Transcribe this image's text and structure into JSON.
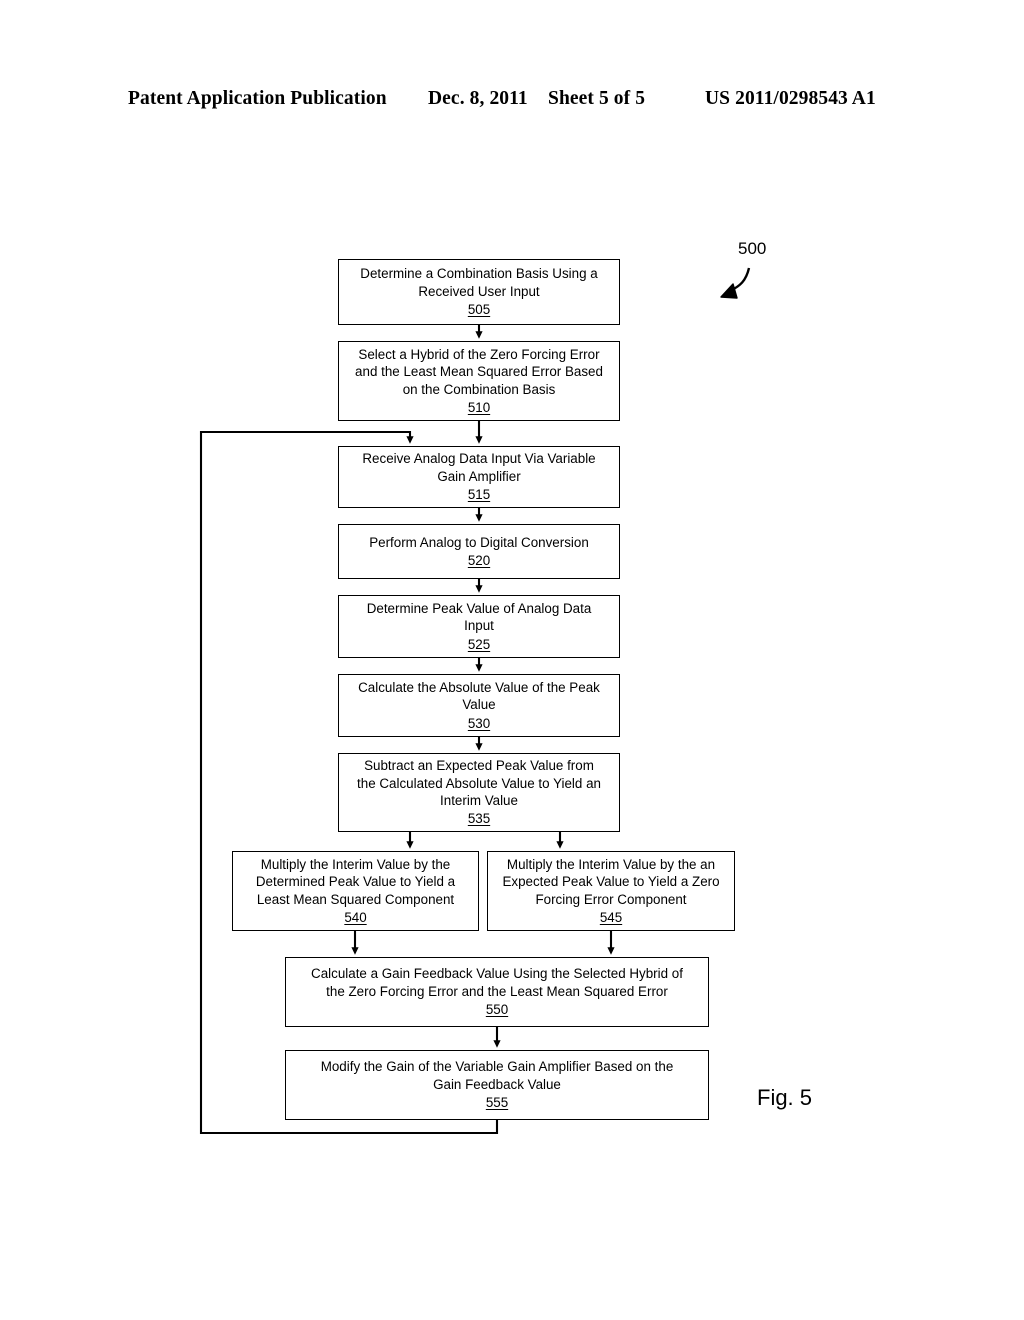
{
  "header": {
    "publication": "Patent Application Publication",
    "date": "Dec. 8, 2011",
    "sheet": "Sheet 5 of 5",
    "patent_number": "US 2011/0298543 A1"
  },
  "figure": {
    "caption": "Fig. 5",
    "reference_numeral": "500"
  },
  "flowchart": {
    "steps": [
      {
        "id": "505",
        "text": "Determine a Combination Basis Using a\nReceived User Input",
        "number": "505"
      },
      {
        "id": "510",
        "text": "Select a Hybrid of the Zero Forcing Error\nand the Least Mean Squared Error Based\non the Combination Basis",
        "number": "510"
      },
      {
        "id": "515",
        "text": "Receive Analog Data Input Via Variable\nGain Amplifier",
        "number": "515"
      },
      {
        "id": "520",
        "text": "Perform Analog to Digital Conversion",
        "number": "520"
      },
      {
        "id": "525",
        "text": "Determine Peak Value of Analog Data\nInput",
        "number": "525"
      },
      {
        "id": "530",
        "text": "Calculate the Absolute Value of the Peak\nValue",
        "number": "530"
      },
      {
        "id": "535",
        "text": "Subtract an Expected Peak Value from\nthe Calculated Absolute Value to Yield an\nInterim Value",
        "number": "535"
      },
      {
        "id": "540",
        "text": "Multiply the Interim Value by the\nDetermined Peak Value to Yield a\nLeast Mean Squared Component",
        "number": "540"
      },
      {
        "id": "545",
        "text": "Multiply the Interim Value by the an\nExpected Peak Value to Yield a Zero\nForcing Error Component",
        "number": "545"
      },
      {
        "id": "550",
        "text": "Calculate a Gain Feedback Value Using the Selected Hybrid of\nthe Zero Forcing Error and the Least Mean Squared Error",
        "number": "550"
      },
      {
        "id": "555",
        "text": "Modify the Gain of the Variable Gain Amplifier Based on the\nGain Feedback Value",
        "number": "555"
      }
    ]
  }
}
